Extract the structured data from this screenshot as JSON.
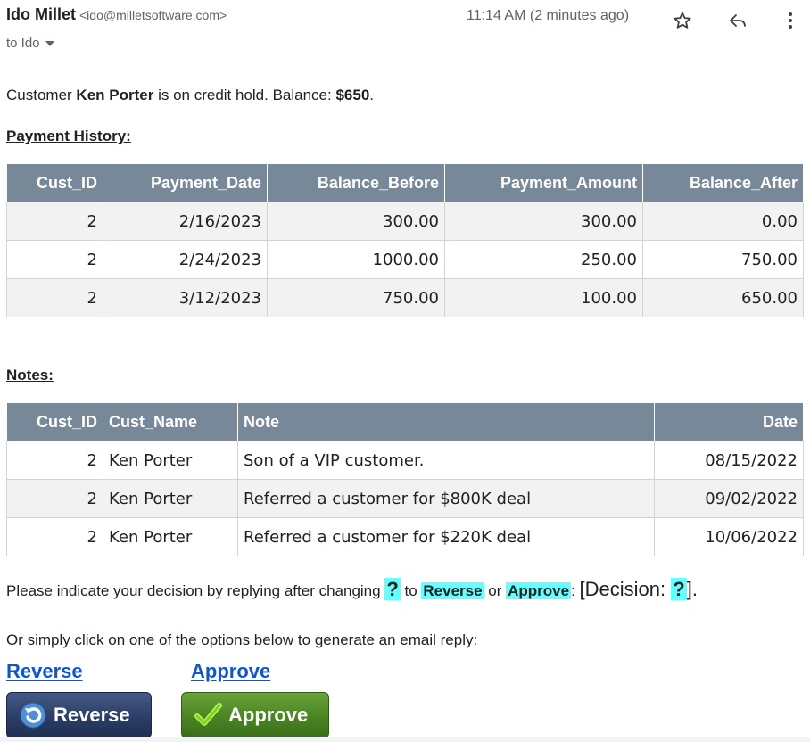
{
  "header": {
    "sender_name": "Ido Millet",
    "sender_email": "<ido@milletsoftware.com>",
    "to_text": "to Ido",
    "time": "11:14 AM (2 minutes ago)",
    "icons": [
      "star-icon",
      "reply-icon",
      "more-vert-icon"
    ]
  },
  "intro": {
    "p1": "Customer ",
    "customer": "Ken Porter",
    "p2": " is on credit hold. Balance: ",
    "balance": "$650",
    "p3": "."
  },
  "payment_history": {
    "title": "Payment History:",
    "columns": [
      "Cust_ID",
      "Payment_Date",
      "Balance_Before",
      "Payment_Amount",
      "Balance_After"
    ],
    "rows": [
      [
        "2",
        "2/16/2023",
        "300.00",
        "300.00",
        "0.00"
      ],
      [
        "2",
        "2/24/2023",
        "1000.00",
        "250.00",
        "750.00"
      ],
      [
        "2",
        "3/12/2023",
        "750.00",
        "100.00",
        "650.00"
      ]
    ]
  },
  "notes": {
    "title": "Notes:",
    "columns": [
      "Cust_ID",
      "Cust_Name",
      "Note",
      "Date"
    ],
    "rows": [
      [
        "2",
        "Ken Porter",
        "Son of a VIP customer.",
        "08/15/2022"
      ],
      [
        "2",
        "Ken Porter",
        "Referred a customer for $800K deal",
        "09/02/2022"
      ],
      [
        "2",
        "Ken Porter",
        "Referred a customer for $220K deal",
        "10/06/2022"
      ]
    ]
  },
  "decision": {
    "p1": "Please indicate your decision by replying after changing ",
    "q": "?",
    "p2": " to ",
    "reverse": "Reverse",
    "p3": " or ",
    "approve": "Approve",
    "p4": ": ",
    "d1": "[Decision: ",
    "d2": "]."
  },
  "options_text": "Or simply click on one of the options below to generate an email reply:",
  "links": {
    "reverse": "Reverse",
    "approve": "Approve"
  },
  "buttons": {
    "reverse": "Reverse",
    "approve": "Approve"
  },
  "colors": {
    "table_header": "#778899",
    "highlight": "#66ffff",
    "link": "#1155cc"
  }
}
